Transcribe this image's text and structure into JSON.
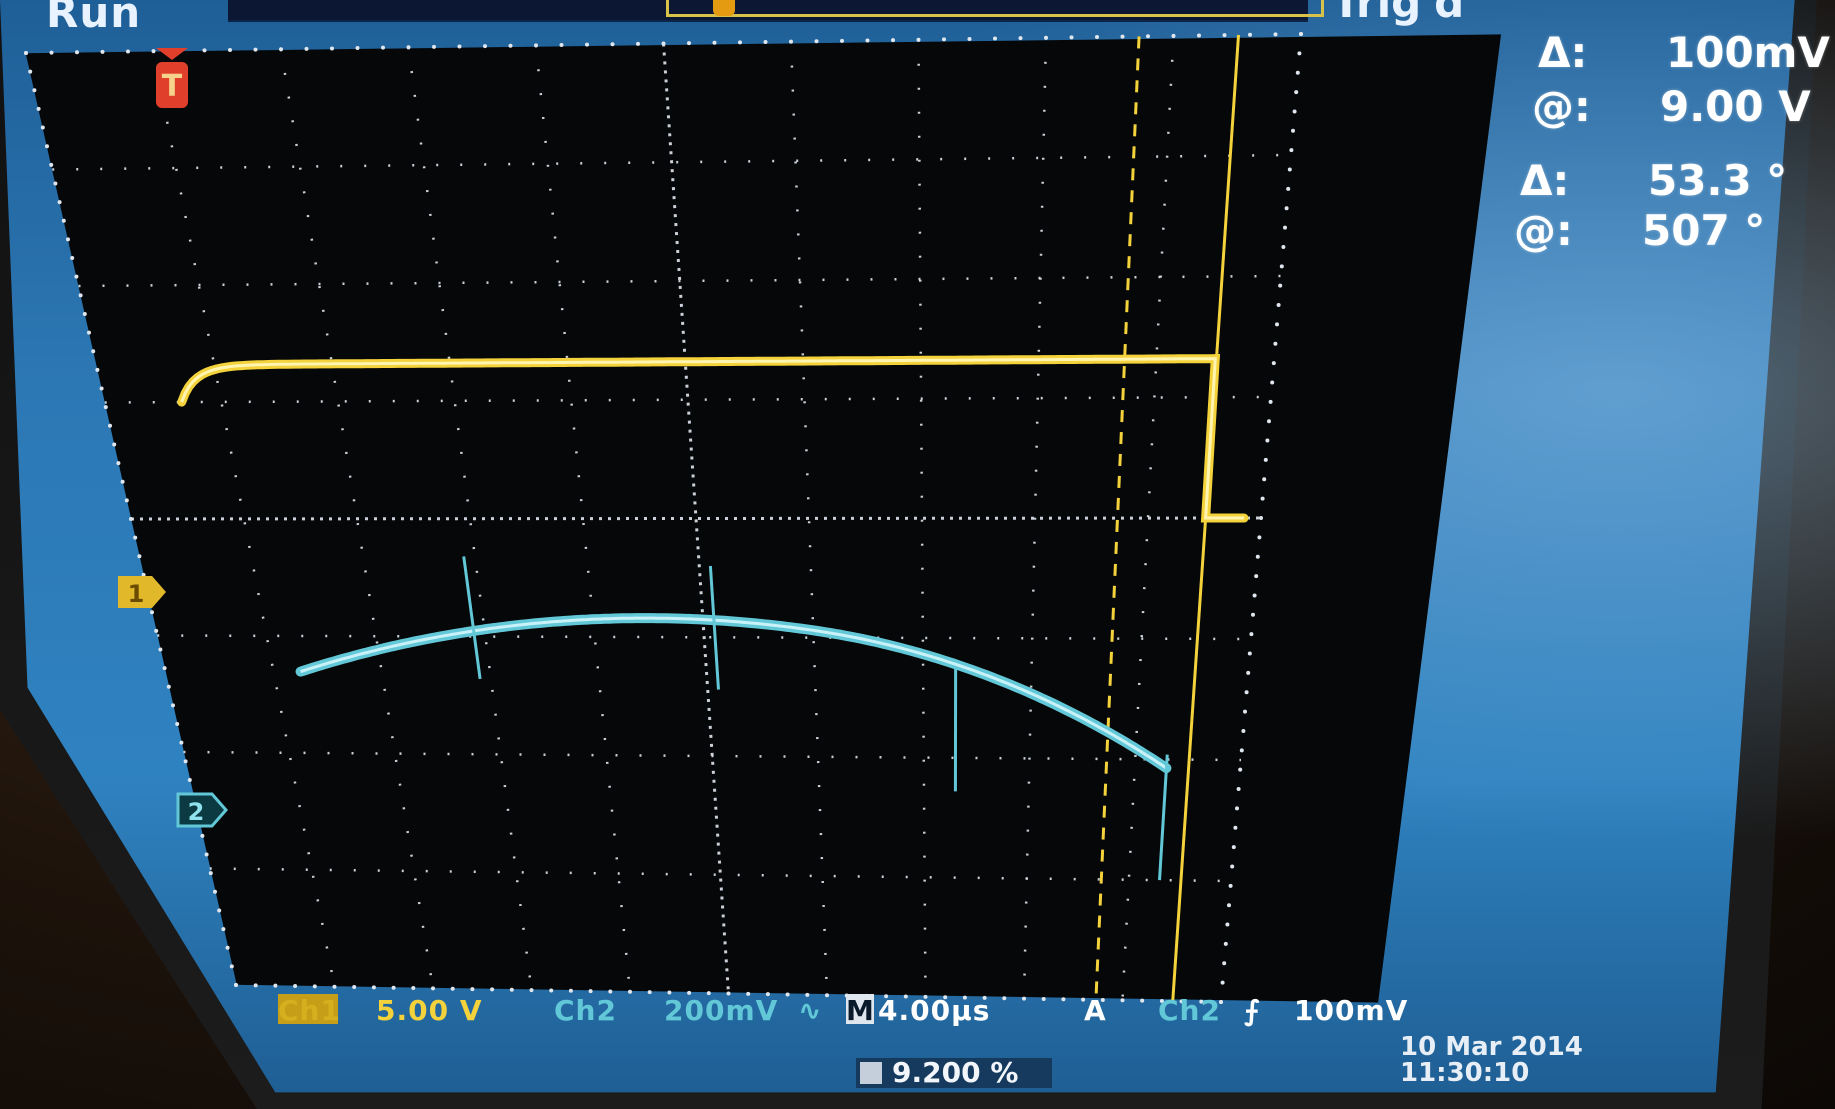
{
  "status": {
    "run_label": "Run",
    "trigger_state": "Trig'd"
  },
  "channels": {
    "ch1": {
      "marker": "1",
      "tag": "Ch1",
      "scale": "5.00 V",
      "color": "#f3d23b"
    },
    "ch2": {
      "marker": "2",
      "tag": "Ch2",
      "scale": "200mV",
      "coupling_icon": "∿",
      "color": "#62c8d8"
    }
  },
  "trigger": {
    "marker": "T",
    "glyph": "A",
    "source": "Ch2",
    "slope_icon": "⨍",
    "level": "100mV"
  },
  "horizontal": {
    "tag": "M",
    "timebase": "4.00µs"
  },
  "cursor_readouts": {
    "voltage": {
      "delta_label": "Δ:",
      "delta_value": "100mV",
      "at_label": "@:",
      "at_value": "9.00 V"
    },
    "phase": {
      "delta_label": "Δ:",
      "delta_value": "53.3 °",
      "at_label": "@:",
      "at_value": "507 °"
    }
  },
  "footer": {
    "percent": "9.200 %",
    "date": "10 Mar 2014",
    "time": "11:30:10"
  },
  "colors": {
    "screen_blue": "#2c78b5",
    "graticule_bg": "#050708",
    "grid": "#dfe6ee"
  }
}
